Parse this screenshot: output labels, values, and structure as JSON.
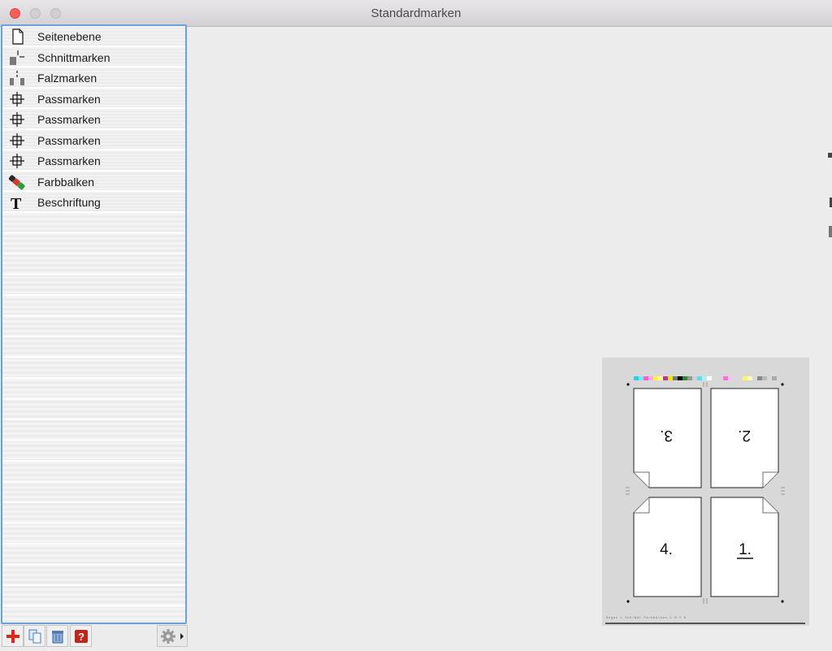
{
  "window": {
    "title": "Standardmarken"
  },
  "list": {
    "items": [
      {
        "label": "Seitenebene",
        "icon": "page-icon"
      },
      {
        "label": "Schnittmarken",
        "icon": "cut-marks-icon"
      },
      {
        "label": "Falzmarken",
        "icon": "fold-marks-icon"
      },
      {
        "label": "Passmarken",
        "icon": "registration-mark-icon"
      },
      {
        "label": "Passmarken",
        "icon": "registration-mark-icon"
      },
      {
        "label": "Passmarken",
        "icon": "registration-mark-icon"
      },
      {
        "label": "Passmarken",
        "icon": "registration-mark-icon"
      },
      {
        "label": "Farbbalken",
        "icon": "color-bar-icon"
      },
      {
        "label": "Beschriftung",
        "icon": "text-label-icon"
      }
    ]
  },
  "toolbar": {
    "buttons": [
      "add-icon",
      "duplicate-icon",
      "trash-icon",
      "help-icon",
      "gear-icon"
    ]
  },
  "preview": {
    "pages": [
      "3.",
      "2.",
      "4.",
      "1."
    ],
    "slug_text": "Bogen 1 Sch/Wdr  Farbbalken  C  M  Y  K"
  },
  "colors": {
    "accent": "#6b9fe0",
    "close": "#fc5f57"
  }
}
